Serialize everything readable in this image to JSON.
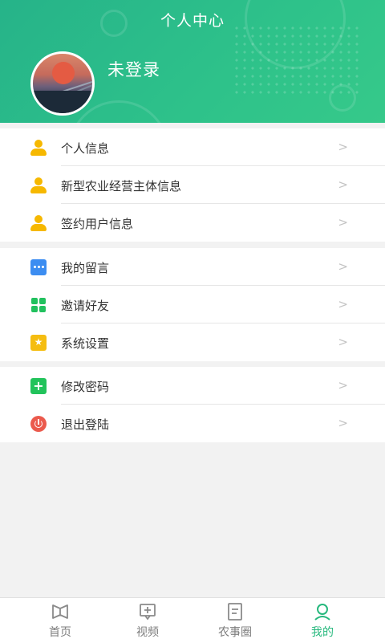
{
  "header": {
    "title": "个人中心",
    "username": "未登录"
  },
  "groups": [
    {
      "items": [
        {
          "label": "个人信息",
          "icon": "user-icon"
        },
        {
          "label": "新型农业经营主体信息",
          "icon": "user-icon"
        },
        {
          "label": "签约用户信息",
          "icon": "user-icon"
        }
      ]
    },
    {
      "items": [
        {
          "label": "我的留言",
          "icon": "message-icon"
        },
        {
          "label": "邀请好友",
          "icon": "grid-icon"
        },
        {
          "label": "系统设置",
          "icon": "star-icon"
        }
      ]
    },
    {
      "items": [
        {
          "label": "修改密码",
          "icon": "plus-icon"
        },
        {
          "label": "退出登陆",
          "icon": "power-icon"
        }
      ]
    }
  ],
  "tabbar": {
    "tabs": [
      {
        "label": "首页",
        "icon": "book-icon"
      },
      {
        "label": "视频",
        "icon": "video-icon"
      },
      {
        "label": "农事圈",
        "icon": "document-icon"
      },
      {
        "label": "我的",
        "icon": "user-outline-icon",
        "active": true
      }
    ]
  },
  "colors": {
    "brand": "#2ec28a",
    "active_tab": "#26b87d",
    "user_icon": "#f6b800"
  }
}
